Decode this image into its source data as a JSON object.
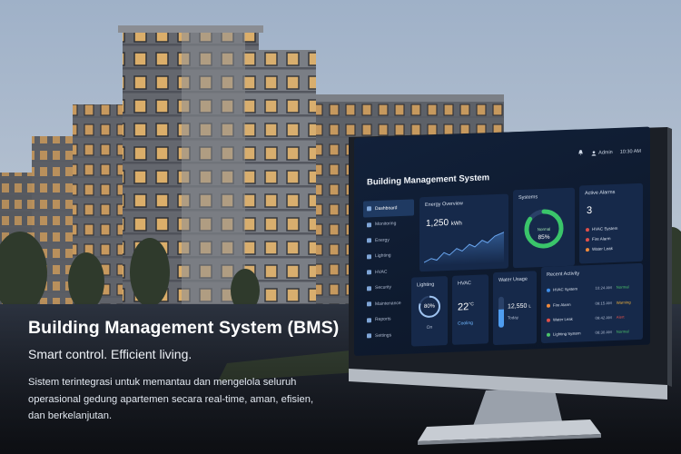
{
  "hero": {
    "title": "Building Management System (BMS)",
    "subtitle": "Smart control. Efficient living.",
    "description": "Sistem terintegrasi untuk memantau dan mengelola seluruh operasional gedung apartemen secara real-time, aman, efisien, dan berkelanjutan."
  },
  "dashboard": {
    "title": "Building Management System",
    "topbar": {
      "user": "Admin",
      "time": "10:30 AM"
    },
    "sidebar": {
      "items": [
        {
          "label": "Dashboard",
          "active": true
        },
        {
          "label": "Monitoring"
        },
        {
          "label": "Energy"
        },
        {
          "label": "Lighting"
        },
        {
          "label": "HVAC"
        },
        {
          "label": "Security"
        },
        {
          "label": "Maintenance"
        },
        {
          "label": "Reports"
        },
        {
          "label": "Settings"
        }
      ]
    },
    "energy": {
      "title": "Energy Overview",
      "value": "1,250",
      "unit": "kWh"
    },
    "systems": {
      "title": "Systems",
      "status": "Normal",
      "value": "85%",
      "fraction": 0.85
    },
    "alarms": {
      "title": "Active Alarms",
      "count": "3",
      "items": [
        {
          "label": "HVAC System",
          "color": "#e0504a"
        },
        {
          "label": "Fire Alarm",
          "color": "#e0504a"
        },
        {
          "label": "Water Leak",
          "color": "#f08a3c"
        }
      ]
    },
    "lighting": {
      "title": "Lighting",
      "value": "80%",
      "state": "On",
      "fraction": 0.8
    },
    "hvac": {
      "title": "HVAC",
      "temp": "22",
      "unit": "°C",
      "mode": "Cooling"
    },
    "water": {
      "title": "Water Usage",
      "value": "12,550",
      "unit": "L",
      "period": "Today",
      "fraction": 0.6
    },
    "recent": {
      "title": "Recent Activity",
      "rows": [
        {
          "name": "HVAC System",
          "time": "10:24 AM",
          "status": "Normal",
          "color": "#4cc46a",
          "icon_color": "#3f8ee8"
        },
        {
          "name": "Fire Alarm",
          "time": "09:15 AM",
          "status": "Warning",
          "color": "#f0b23c",
          "icon_color": "#f08a3c"
        },
        {
          "name": "Water Leak",
          "time": "09:42 AM",
          "status": "Alert",
          "color": "#e0504a",
          "icon_color": "#e0504a"
        },
        {
          "name": "Lighting System",
          "time": "08:30 AM",
          "status": "Normal",
          "color": "#4cc46a",
          "icon_color": "#4cc46a"
        }
      ]
    }
  }
}
